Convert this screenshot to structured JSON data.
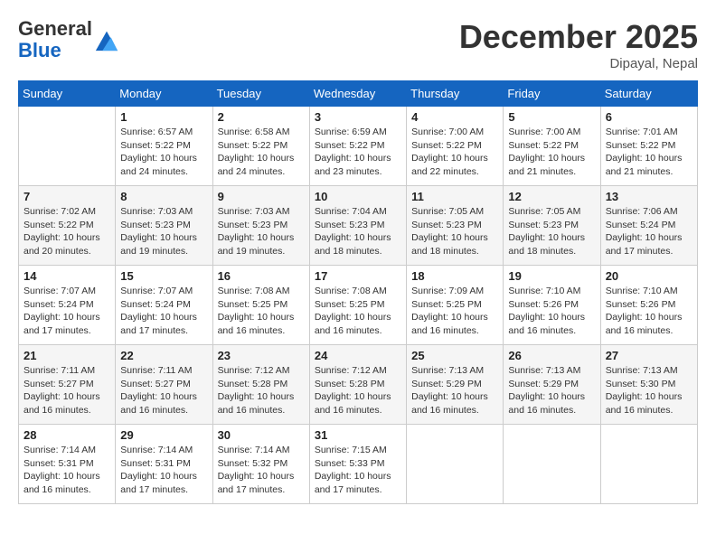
{
  "header": {
    "logo_general": "General",
    "logo_blue": "Blue",
    "month_title": "December 2025",
    "location": "Dipayal, Nepal"
  },
  "calendar": {
    "days_of_week": [
      "Sunday",
      "Monday",
      "Tuesday",
      "Wednesday",
      "Thursday",
      "Friday",
      "Saturday"
    ],
    "weeks": [
      [
        {
          "day": "",
          "info": ""
        },
        {
          "day": "1",
          "info": "Sunrise: 6:57 AM\nSunset: 5:22 PM\nDaylight: 10 hours\nand 24 minutes."
        },
        {
          "day": "2",
          "info": "Sunrise: 6:58 AM\nSunset: 5:22 PM\nDaylight: 10 hours\nand 24 minutes."
        },
        {
          "day": "3",
          "info": "Sunrise: 6:59 AM\nSunset: 5:22 PM\nDaylight: 10 hours\nand 23 minutes."
        },
        {
          "day": "4",
          "info": "Sunrise: 7:00 AM\nSunset: 5:22 PM\nDaylight: 10 hours\nand 22 minutes."
        },
        {
          "day": "5",
          "info": "Sunrise: 7:00 AM\nSunset: 5:22 PM\nDaylight: 10 hours\nand 21 minutes."
        },
        {
          "day": "6",
          "info": "Sunrise: 7:01 AM\nSunset: 5:22 PM\nDaylight: 10 hours\nand 21 minutes."
        }
      ],
      [
        {
          "day": "7",
          "info": "Sunrise: 7:02 AM\nSunset: 5:22 PM\nDaylight: 10 hours\nand 20 minutes."
        },
        {
          "day": "8",
          "info": "Sunrise: 7:03 AM\nSunset: 5:23 PM\nDaylight: 10 hours\nand 19 minutes."
        },
        {
          "day": "9",
          "info": "Sunrise: 7:03 AM\nSunset: 5:23 PM\nDaylight: 10 hours\nand 19 minutes."
        },
        {
          "day": "10",
          "info": "Sunrise: 7:04 AM\nSunset: 5:23 PM\nDaylight: 10 hours\nand 18 minutes."
        },
        {
          "day": "11",
          "info": "Sunrise: 7:05 AM\nSunset: 5:23 PM\nDaylight: 10 hours\nand 18 minutes."
        },
        {
          "day": "12",
          "info": "Sunrise: 7:05 AM\nSunset: 5:23 PM\nDaylight: 10 hours\nand 18 minutes."
        },
        {
          "day": "13",
          "info": "Sunrise: 7:06 AM\nSunset: 5:24 PM\nDaylight: 10 hours\nand 17 minutes."
        }
      ],
      [
        {
          "day": "14",
          "info": "Sunrise: 7:07 AM\nSunset: 5:24 PM\nDaylight: 10 hours\nand 17 minutes."
        },
        {
          "day": "15",
          "info": "Sunrise: 7:07 AM\nSunset: 5:24 PM\nDaylight: 10 hours\nand 17 minutes."
        },
        {
          "day": "16",
          "info": "Sunrise: 7:08 AM\nSunset: 5:25 PM\nDaylight: 10 hours\nand 16 minutes."
        },
        {
          "day": "17",
          "info": "Sunrise: 7:08 AM\nSunset: 5:25 PM\nDaylight: 10 hours\nand 16 minutes."
        },
        {
          "day": "18",
          "info": "Sunrise: 7:09 AM\nSunset: 5:25 PM\nDaylight: 10 hours\nand 16 minutes."
        },
        {
          "day": "19",
          "info": "Sunrise: 7:10 AM\nSunset: 5:26 PM\nDaylight: 10 hours\nand 16 minutes."
        },
        {
          "day": "20",
          "info": "Sunrise: 7:10 AM\nSunset: 5:26 PM\nDaylight: 10 hours\nand 16 minutes."
        }
      ],
      [
        {
          "day": "21",
          "info": "Sunrise: 7:11 AM\nSunset: 5:27 PM\nDaylight: 10 hours\nand 16 minutes."
        },
        {
          "day": "22",
          "info": "Sunrise: 7:11 AM\nSunset: 5:27 PM\nDaylight: 10 hours\nand 16 minutes."
        },
        {
          "day": "23",
          "info": "Sunrise: 7:12 AM\nSunset: 5:28 PM\nDaylight: 10 hours\nand 16 minutes."
        },
        {
          "day": "24",
          "info": "Sunrise: 7:12 AM\nSunset: 5:28 PM\nDaylight: 10 hours\nand 16 minutes."
        },
        {
          "day": "25",
          "info": "Sunrise: 7:13 AM\nSunset: 5:29 PM\nDaylight: 10 hours\nand 16 minutes."
        },
        {
          "day": "26",
          "info": "Sunrise: 7:13 AM\nSunset: 5:29 PM\nDaylight: 10 hours\nand 16 minutes."
        },
        {
          "day": "27",
          "info": "Sunrise: 7:13 AM\nSunset: 5:30 PM\nDaylight: 10 hours\nand 16 minutes."
        }
      ],
      [
        {
          "day": "28",
          "info": "Sunrise: 7:14 AM\nSunset: 5:31 PM\nDaylight: 10 hours\nand 16 minutes."
        },
        {
          "day": "29",
          "info": "Sunrise: 7:14 AM\nSunset: 5:31 PM\nDaylight: 10 hours\nand 17 minutes."
        },
        {
          "day": "30",
          "info": "Sunrise: 7:14 AM\nSunset: 5:32 PM\nDaylight: 10 hours\nand 17 minutes."
        },
        {
          "day": "31",
          "info": "Sunrise: 7:15 AM\nSunset: 5:33 PM\nDaylight: 10 hours\nand 17 minutes."
        },
        {
          "day": "",
          "info": ""
        },
        {
          "day": "",
          "info": ""
        },
        {
          "day": "",
          "info": ""
        }
      ]
    ]
  }
}
